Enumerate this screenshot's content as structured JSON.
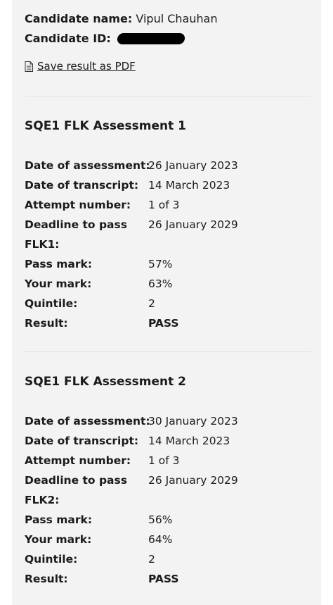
{
  "candidate": {
    "name_label": "Candidate name:",
    "name_value": "Vipul Chauhan",
    "id_label": "Candidate ID:"
  },
  "save_pdf": {
    "label": "Save result as PDF",
    "icon": "document-icon"
  },
  "assessments": [
    {
      "title": "SQE1 FLK Assessment 1",
      "rows": [
        {
          "label": "Date of assessment:",
          "value": "26 January 2023"
        },
        {
          "label": "Date of transcript:",
          "value": "14 March 2023"
        },
        {
          "label": "Attempt number:",
          "value": "1 of 3"
        },
        {
          "label": "Deadline to pass",
          "value": "26 January 2029"
        },
        {
          "label": "FLK1:",
          "value": ""
        },
        {
          "label": "Pass mark:",
          "value": "57%"
        },
        {
          "label": "Your mark:",
          "value": "63%"
        },
        {
          "label": "Quintile:",
          "value": "2"
        },
        {
          "label": "Result:",
          "value": "PASS"
        }
      ]
    },
    {
      "title": "SQE1 FLK Assessment 2",
      "rows": [
        {
          "label": "Date of assessment:",
          "value": "30 January 2023"
        },
        {
          "label": "Date of transcript:",
          "value": "14 March 2023"
        },
        {
          "label": "Attempt number:",
          "value": "1 of 3"
        },
        {
          "label": "Deadline to pass",
          "value": "26 January 2029"
        },
        {
          "label": "FLK2:",
          "value": ""
        },
        {
          "label": "Pass mark:",
          "value": "56%"
        },
        {
          "label": "Your mark:",
          "value": "64%"
        },
        {
          "label": "Quintile:",
          "value": "2"
        },
        {
          "label": "Result:",
          "value": "PASS"
        }
      ]
    }
  ]
}
